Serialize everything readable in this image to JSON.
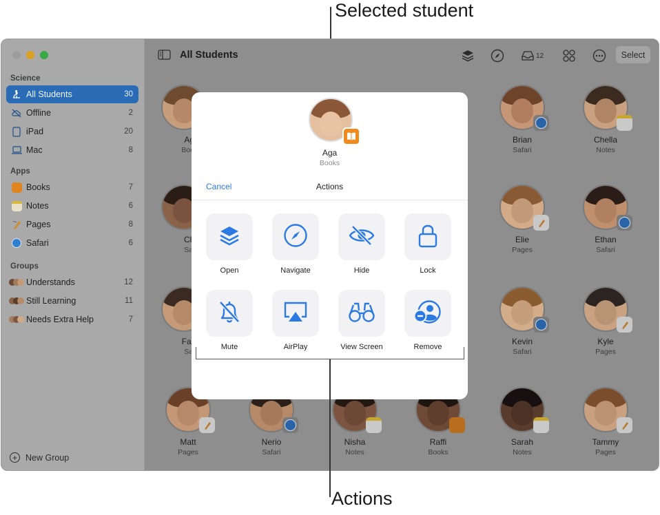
{
  "annotations": {
    "selected_student": "Selected student",
    "actions": "Actions"
  },
  "sidebar": {
    "sections": [
      {
        "title": "Science",
        "items": [
          {
            "label": "All Students",
            "count": "30",
            "icon": "microscope-icon",
            "selected": true
          },
          {
            "label": "Offline",
            "count": "2",
            "icon": "cloud-offline-icon"
          },
          {
            "label": "iPad",
            "count": "20",
            "icon": "ipad-icon"
          },
          {
            "label": "Mac",
            "count": "8",
            "icon": "laptop-icon"
          }
        ]
      },
      {
        "title": "Apps",
        "items": [
          {
            "label": "Books",
            "count": "7",
            "icon": "books-app-icon"
          },
          {
            "label": "Notes",
            "count": "6",
            "icon": "notes-app-icon"
          },
          {
            "label": "Pages",
            "count": "8",
            "icon": "pages-app-icon"
          },
          {
            "label": "Safari",
            "count": "6",
            "icon": "safari-app-icon"
          }
        ]
      },
      {
        "title": "Groups",
        "items": [
          {
            "label": "Understands",
            "count": "12",
            "icon": "group-avatars-icon"
          },
          {
            "label": "Still Learning",
            "count": "11",
            "icon": "group-avatars-icon"
          },
          {
            "label": "Needs Extra Help",
            "count": "7",
            "icon": "group-avatars-icon"
          }
        ]
      }
    ],
    "new_group": "New Group"
  },
  "toolbar": {
    "title": "All Students",
    "inbox_count": "12",
    "select_label": "Select"
  },
  "students": [
    {
      "name": "Aga",
      "app": "Books"
    },
    {
      "name": "Brian",
      "app": "Safari"
    },
    {
      "name": "Chella",
      "app": "Notes"
    },
    {
      "name": "Chri",
      "app": "Safa"
    },
    {
      "name": "Elie",
      "app": "Pages"
    },
    {
      "name": "Ethan",
      "app": "Safari"
    },
    {
      "name": "Farra",
      "app": "Safa"
    },
    {
      "name": "Kevin",
      "app": "Safari"
    },
    {
      "name": "Kyle",
      "app": "Pages"
    },
    {
      "name": "Matt",
      "app": "Pages"
    },
    {
      "name": "Nerio",
      "app": "Safari"
    },
    {
      "name": "Nisha",
      "app": "Notes"
    },
    {
      "name": "Raffi",
      "app": "Books"
    },
    {
      "name": "Sarah",
      "app": "Notes"
    },
    {
      "name": "Tammy",
      "app": "Pages"
    }
  ],
  "modal": {
    "student_name": "Aga",
    "student_app": "Books",
    "cancel": "Cancel",
    "title": "Actions",
    "actions": [
      {
        "label": "Open",
        "icon": "layers-icon"
      },
      {
        "label": "Navigate",
        "icon": "compass-icon"
      },
      {
        "label": "Hide",
        "icon": "eye-slash-icon"
      },
      {
        "label": "Lock",
        "icon": "lock-icon"
      },
      {
        "label": "Mute",
        "icon": "bell-slash-icon"
      },
      {
        "label": "AirPlay",
        "icon": "airplay-icon"
      },
      {
        "label": "View Screen",
        "icon": "binoculars-icon"
      },
      {
        "label": "Remove",
        "icon": "person-remove-icon"
      }
    ]
  },
  "colors": {
    "accent": "#2a7ae2",
    "sidebar_selected": "#2a6bb6",
    "books_badge": "#f08a1c",
    "notes_badge": "#f6d94a",
    "safari_badge": "#2f86e6"
  }
}
